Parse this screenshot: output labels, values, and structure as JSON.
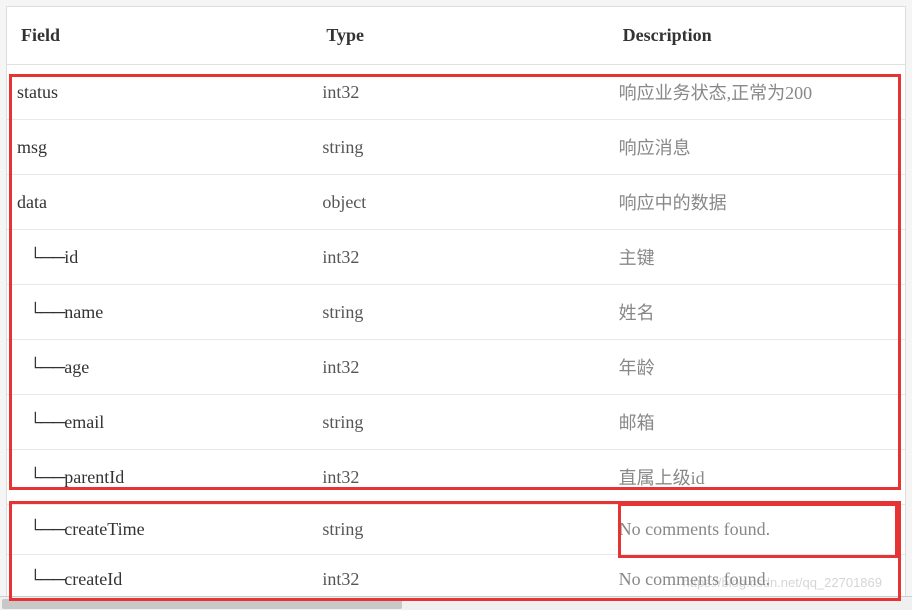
{
  "headers": {
    "field": "Field",
    "type": "Type",
    "description": "Description"
  },
  "rows": [
    {
      "field": "status",
      "type": "int32",
      "description": "响应业务状态,正常为200",
      "indent": false
    },
    {
      "field": "msg",
      "type": "string",
      "description": "响应消息",
      "indent": false
    },
    {
      "field": "data",
      "type": "object",
      "description": "响应中的数据",
      "indent": false
    },
    {
      "field": "id",
      "type": "int32",
      "description": "主键",
      "indent": true
    },
    {
      "field": "name",
      "type": "string",
      "description": "姓名",
      "indent": true
    },
    {
      "field": "age",
      "type": "int32",
      "description": "年龄",
      "indent": true
    },
    {
      "field": "email",
      "type": "string",
      "description": "邮箱",
      "indent": true
    },
    {
      "field": "parentId",
      "type": "int32",
      "description": "直属上级id",
      "indent": true
    },
    {
      "field": "createTime",
      "type": "string",
      "description": "No comments found.",
      "indent": true
    },
    {
      "field": "createId",
      "type": "int32",
      "description": "No comments found.",
      "indent": true
    }
  ],
  "tree_prefix": "└──",
  "watermark": "https://blog.csdn.net/qq_22701869"
}
